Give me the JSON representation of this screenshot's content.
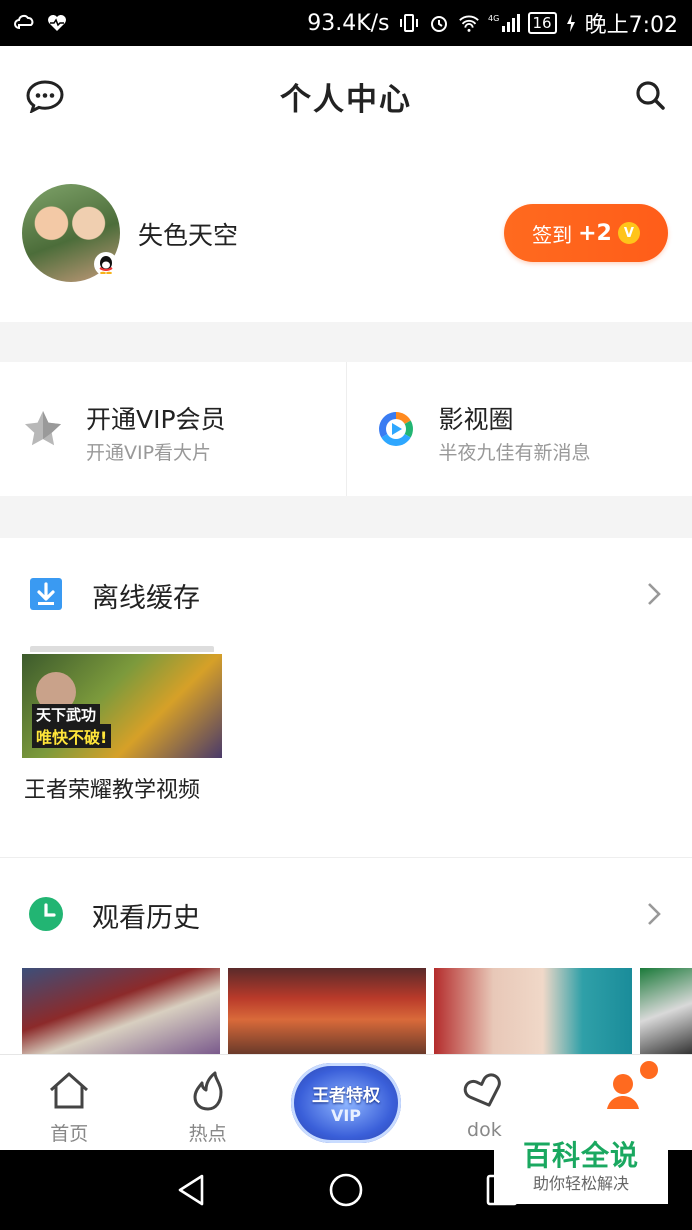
{
  "status_bar": {
    "net_speed": "93.4K/s",
    "network_type": "4G",
    "battery": "16",
    "time": "晚上7:02",
    "icons": [
      "cloud-icon",
      "heart-rate-icon",
      "vibrate-icon",
      "alarm-icon",
      "wifi-icon",
      "signal-icon",
      "charging-icon"
    ]
  },
  "header": {
    "title": "个人中心",
    "left_icon": "message-bubble-icon",
    "right_icon": "search-icon"
  },
  "profile": {
    "username": "失色天空",
    "checkin_label": "签到",
    "checkin_points": "+2",
    "coin_symbol": "V"
  },
  "features": [
    {
      "title": "开通VIP会员",
      "subtitle": "开通VIP看大片",
      "icon": "star-icon"
    },
    {
      "title": "影视圈",
      "subtitle": "半夜九佳有新消息",
      "icon": "play-circle-icon"
    }
  ],
  "offline": {
    "title": "离线缓存",
    "icon": "download-icon",
    "item": {
      "title": "王者荣耀教学视频",
      "caption_line1": "天下武功",
      "caption_line2": "唯快不破!"
    }
  },
  "history": {
    "title": "观看历史",
    "icon": "clock-icon"
  },
  "bottom_nav": [
    {
      "label": "首页",
      "icon": "home-icon"
    },
    {
      "label": "热点",
      "icon": "flame-icon"
    },
    {
      "label": "",
      "icon": "vip-promo-badge",
      "badge_line1": "王者特权",
      "badge_line2": "VIP"
    },
    {
      "label": "dok",
      "icon": "doki-heart-icon"
    },
    {
      "label": "",
      "icon": "person-icon"
    }
  ],
  "watermark": {
    "line1": "百科全说",
    "line2": "助你轻松解决"
  },
  "colors": {
    "accent": "#ff6a1f",
    "download_blue": "#3a9af2",
    "clock_green": "#22b573",
    "watermark_green": "#1aa860"
  }
}
